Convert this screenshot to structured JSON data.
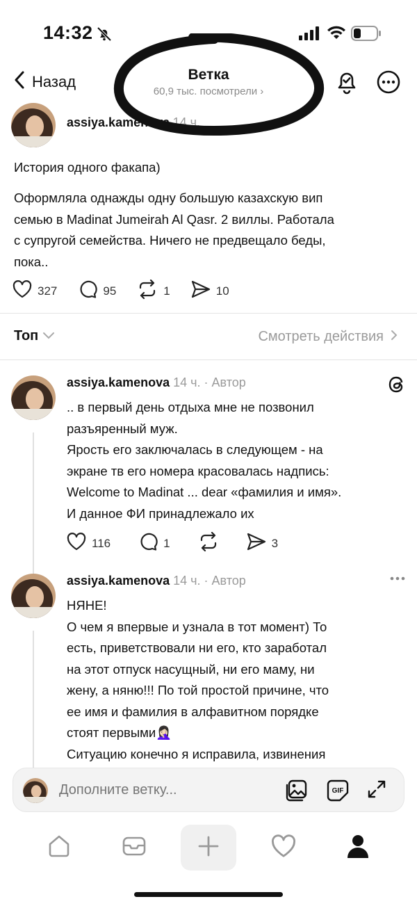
{
  "status_bar": {
    "time": "14:32"
  },
  "header": {
    "back_label": "Назад",
    "title": "Ветка",
    "views": "60,9 тыс. посмотрели ›"
  },
  "post": {
    "username": "assiya.kamenova",
    "time": "14 ч.",
    "title": "История одного факапа)",
    "body_lines": [
      "Оформляла однажды одну большую казахскую вип",
      "семью в Madinat Jumeirah Al Qasr. 2 виллы. Работала",
      "с супругой семейства. Ничего не предвещало беды,",
      "пока.."
    ],
    "likes": "327",
    "comments": "95",
    "reposts": "1",
    "shares": "10"
  },
  "sort": {
    "label": "Топ",
    "view_actions": "Смотреть действия"
  },
  "replies": [
    {
      "username": "assiya.kamenova",
      "meta": "14 ч. · Автор",
      "lines": [
        ".. в первый день отдыха мне не позвонил",
        "разъяренный муж.",
        "Ярость его заключалась в следующем - на",
        "экране тв его номера красовалась надпись:",
        "Welcome to Madinat ... dear «фамилия и имя».",
        "И данное ФИ принадлежало их"
      ],
      "likes": "116",
      "comments": "1",
      "shares": "3"
    },
    {
      "username": "assiya.kamenova",
      "meta": "14 ч. · Автор",
      "lines": [
        "НЯНЕ!",
        "О чем я впервые и узнала в тот момент) То",
        "есть, приветствовали ни его, кто заработал",
        "на этот отпуск насущный, ни его маму, ни",
        "жену, а няню!!! По той простой причине, что",
        "ее имя и фамилия в алфавитном порядке",
        "стоят первыми🤦🏻‍♀️",
        "Ситуацию конечно я исправила, извинения"
      ]
    }
  ],
  "compose": {
    "placeholder": "Дополните ветку..."
  },
  "colors": {
    "text": "#111111",
    "muted": "#9a9a9a",
    "divider": "#e4e4e4"
  },
  "icons": [
    "bell-off-icon",
    "signal-icon",
    "wifi-icon",
    "battery-icon",
    "chevron-left-icon",
    "bell-check-icon",
    "more-icon",
    "heart-icon",
    "comment-icon",
    "repost-icon",
    "share-icon",
    "chevron-down-icon",
    "chevron-right-icon",
    "threads-icon",
    "ellipsis-icon",
    "gallery-icon",
    "gif-icon",
    "expand-icon",
    "home-icon",
    "inbox-icon",
    "plus-icon",
    "profile-icon"
  ]
}
